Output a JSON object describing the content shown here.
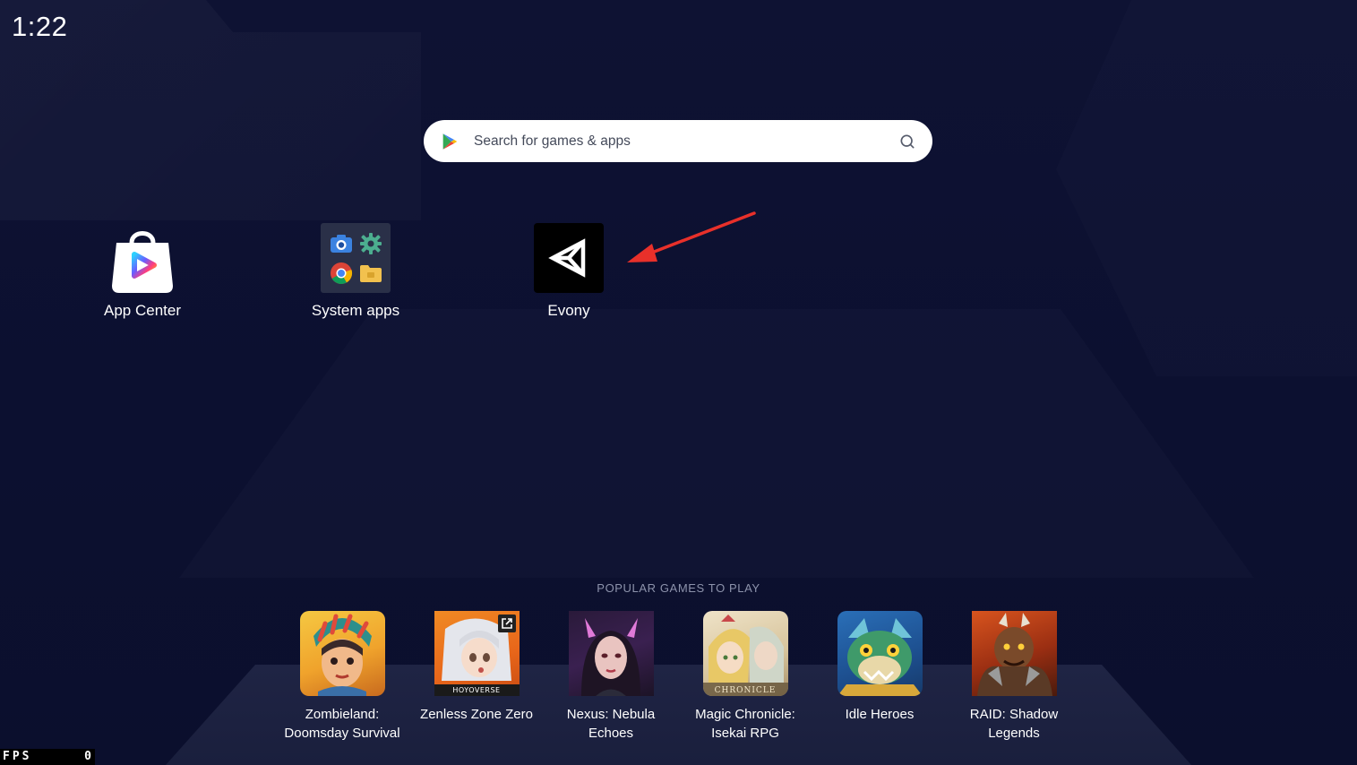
{
  "status": {
    "time": "1:22"
  },
  "search": {
    "placeholder": "Search for games & apps"
  },
  "apps": [
    {
      "label": "App Center"
    },
    {
      "label": "System apps"
    },
    {
      "label": "Evony"
    }
  ],
  "popular": {
    "title": "POPULAR GAMES TO PLAY",
    "games": [
      {
        "label": "Zombieland: Doomsday Survival"
      },
      {
        "label": "Zenless Zone Zero",
        "badge": "HOYOVERSE"
      },
      {
        "label": "Nexus: Nebula Echoes"
      },
      {
        "label": "Magic Chronicle: Isekai RPG",
        "badge": "CHRONICLE"
      },
      {
        "label": "Idle Heroes"
      },
      {
        "label": "RAID: Shadow Legends"
      }
    ]
  },
  "fps": {
    "label": "FPS",
    "value": "0"
  },
  "colors": {
    "background": "#0d1130",
    "floor": "#1f2444",
    "arrow": "#e8302a",
    "search_bg": "#ffffff"
  },
  "icons": [
    "play-store-icon",
    "search-icon",
    "app-center-icon",
    "camera-icon",
    "gear-icon",
    "chrome-icon",
    "folder-icon",
    "unity-logo-icon",
    "external-link-icon"
  ]
}
